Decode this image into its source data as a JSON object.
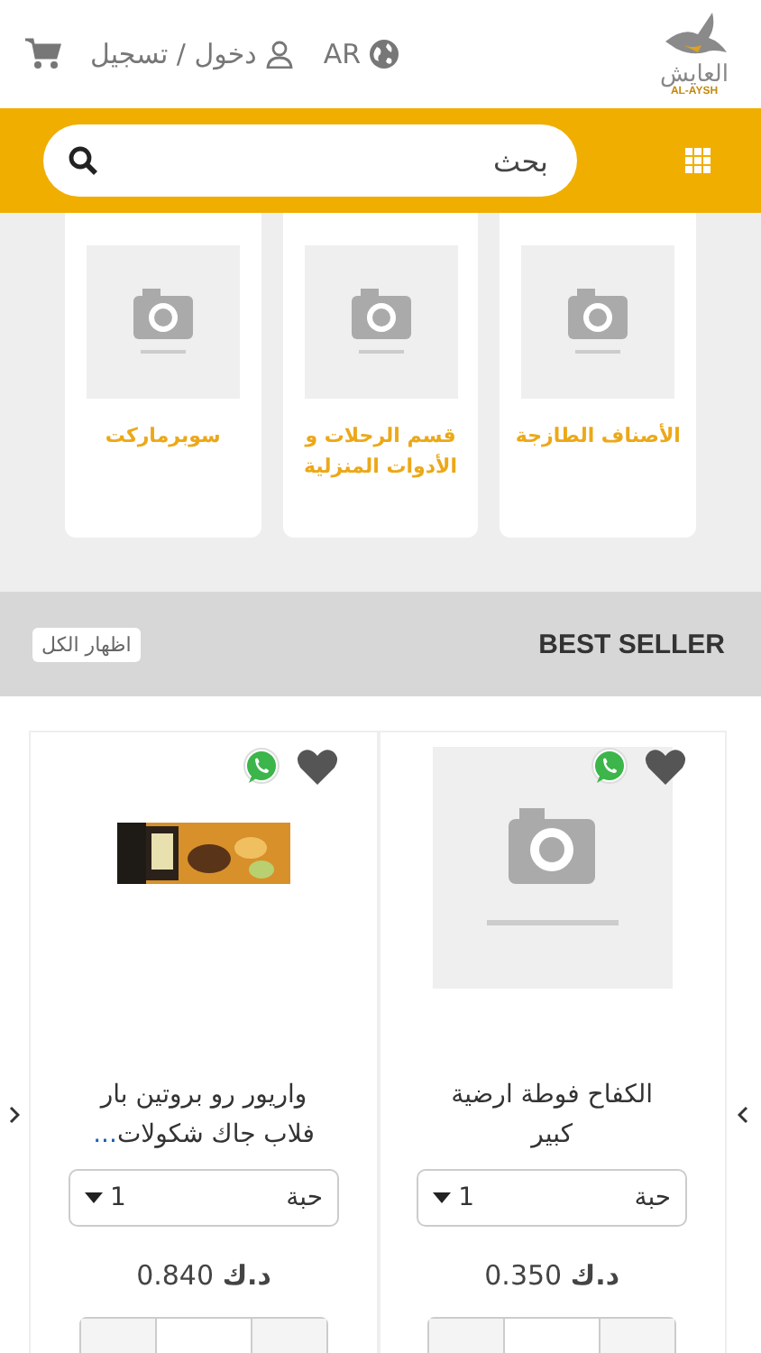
{
  "header": {
    "logo_text": "العايش",
    "logo_subtext": "AL-AYSH",
    "language": "AR",
    "account_link": "دخول / تسجيل"
  },
  "search": {
    "placeholder": "بحث"
  },
  "categories": [
    {
      "title": "الأصناف الطازجة"
    },
    {
      "title": "قسم الرحلات و الأدوات المنزلية"
    },
    {
      "title": "سوبرماركت"
    }
  ],
  "best_seller": {
    "title": "BEST SELLER",
    "show_all": "اظهار الكل"
  },
  "products": [
    {
      "name": "الكفاح فوطة ارضية كبير",
      "kind": "placeholder",
      "unit": "حبة",
      "quantity": "1",
      "price": "**د.ك** 0.350"
    },
    {
      "name": "واريور رو بروتين بار فلاب جاك شكولات",
      "name_more": "...",
      "kind": "product",
      "unit": "حبة",
      "quantity": "1",
      "price": "**د.ك** 0.840"
    }
  ]
}
